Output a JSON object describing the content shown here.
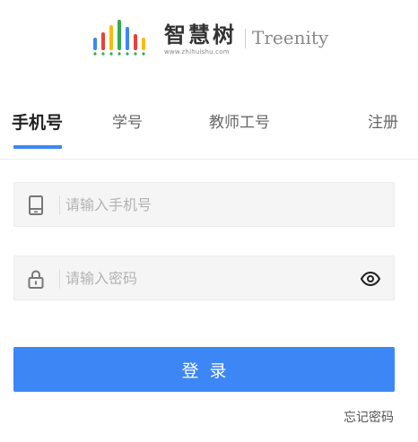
{
  "logo": {
    "cn_text": "智慧树",
    "url_text": "www.zhihuishu.com",
    "en_text": "Treenity",
    "bar_colors": [
      "#3d86f5",
      "#e94235",
      "#f9bb05",
      "#34a853",
      "#3d86f5",
      "#e94235",
      "#f9bb05"
    ]
  },
  "tabs": {
    "phone": "手机号",
    "student_id": "学号",
    "teacher_id": "教师工号",
    "register": "注册"
  },
  "form": {
    "phone_placeholder": "请输入手机号",
    "phone_value": "",
    "password_placeholder": "请输入密码",
    "password_value": "",
    "login_label": "登录",
    "forgot_label": "忘记密码"
  },
  "colors": {
    "accent": "#3d86f5"
  }
}
